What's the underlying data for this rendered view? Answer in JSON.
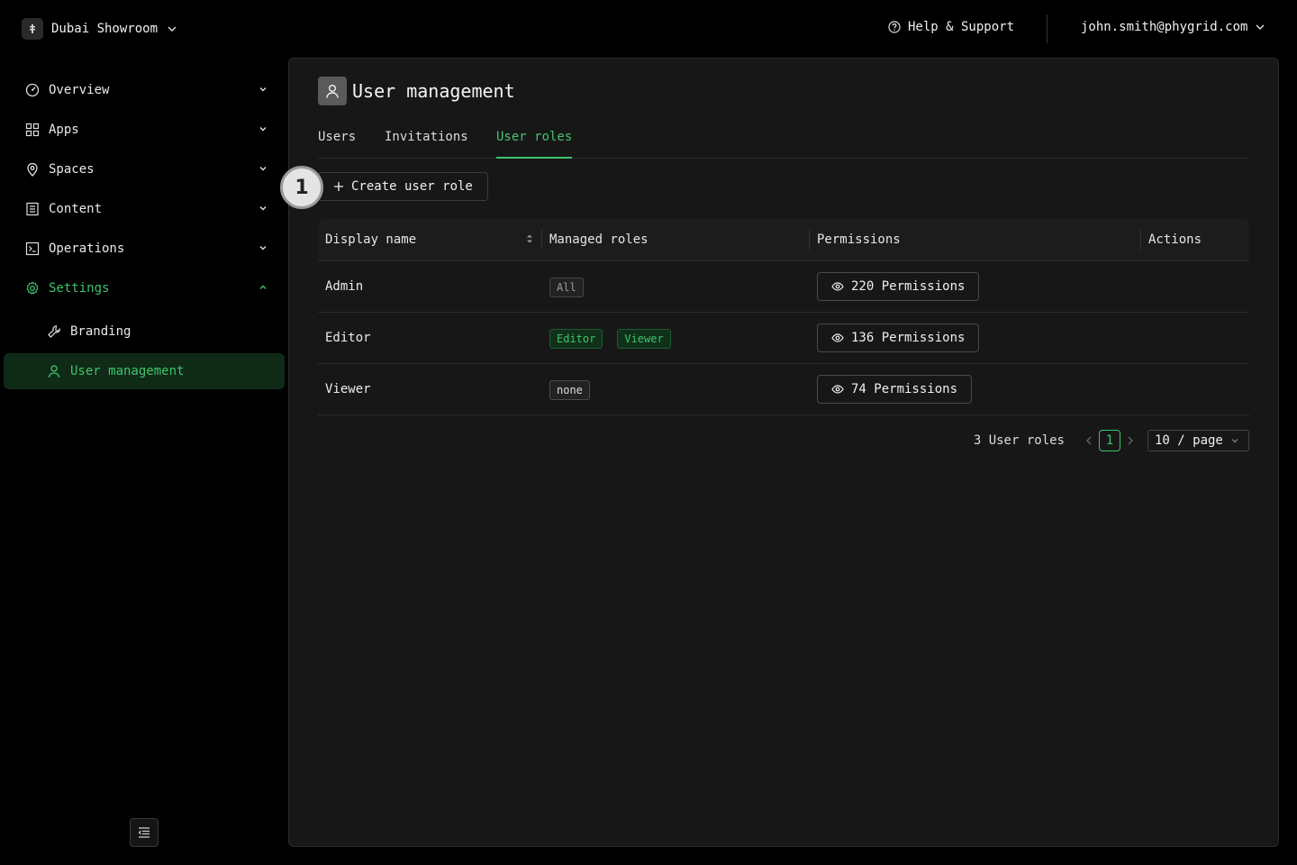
{
  "header": {
    "org_name": "Dubai Showroom",
    "help_label": "Help & Support",
    "user_email": "john.smith@phygrid.com"
  },
  "sidebar": {
    "items": [
      {
        "label": "Overview",
        "icon": "gauge-icon"
      },
      {
        "label": "Apps",
        "icon": "grid-icon"
      },
      {
        "label": "Spaces",
        "icon": "location-pin-icon"
      },
      {
        "label": "Content",
        "icon": "content-icon"
      },
      {
        "label": "Operations",
        "icon": "terminal-icon"
      },
      {
        "label": "Settings",
        "icon": "gear-icon"
      }
    ],
    "sub_items": [
      {
        "label": "Branding",
        "icon": "wrench-icon"
      },
      {
        "label": "User management",
        "icon": "user-icon"
      }
    ]
  },
  "page": {
    "title": "User management",
    "tabs": [
      "Users",
      "Invitations",
      "User roles"
    ],
    "active_tab": "User roles",
    "create_button": "Create user role",
    "step_badge": "1"
  },
  "table": {
    "columns": [
      "Display name",
      "Managed roles",
      "Permissions",
      "Actions"
    ],
    "rows": [
      {
        "name": "Admin",
        "roles": [
          "All"
        ],
        "permissions": "220 Permissions"
      },
      {
        "name": "Editor",
        "roles": [
          "Editor",
          "Viewer"
        ],
        "permissions": "136 Permissions"
      },
      {
        "name": "Viewer",
        "roles": [
          "none"
        ],
        "permissions": "74 Permissions"
      }
    ]
  },
  "pagination": {
    "total": "3 User roles",
    "current_page": "1",
    "page_size": "10 / page"
  },
  "colors": {
    "accent": "#3ec46d",
    "background": "#000000",
    "panel": "#171717"
  }
}
